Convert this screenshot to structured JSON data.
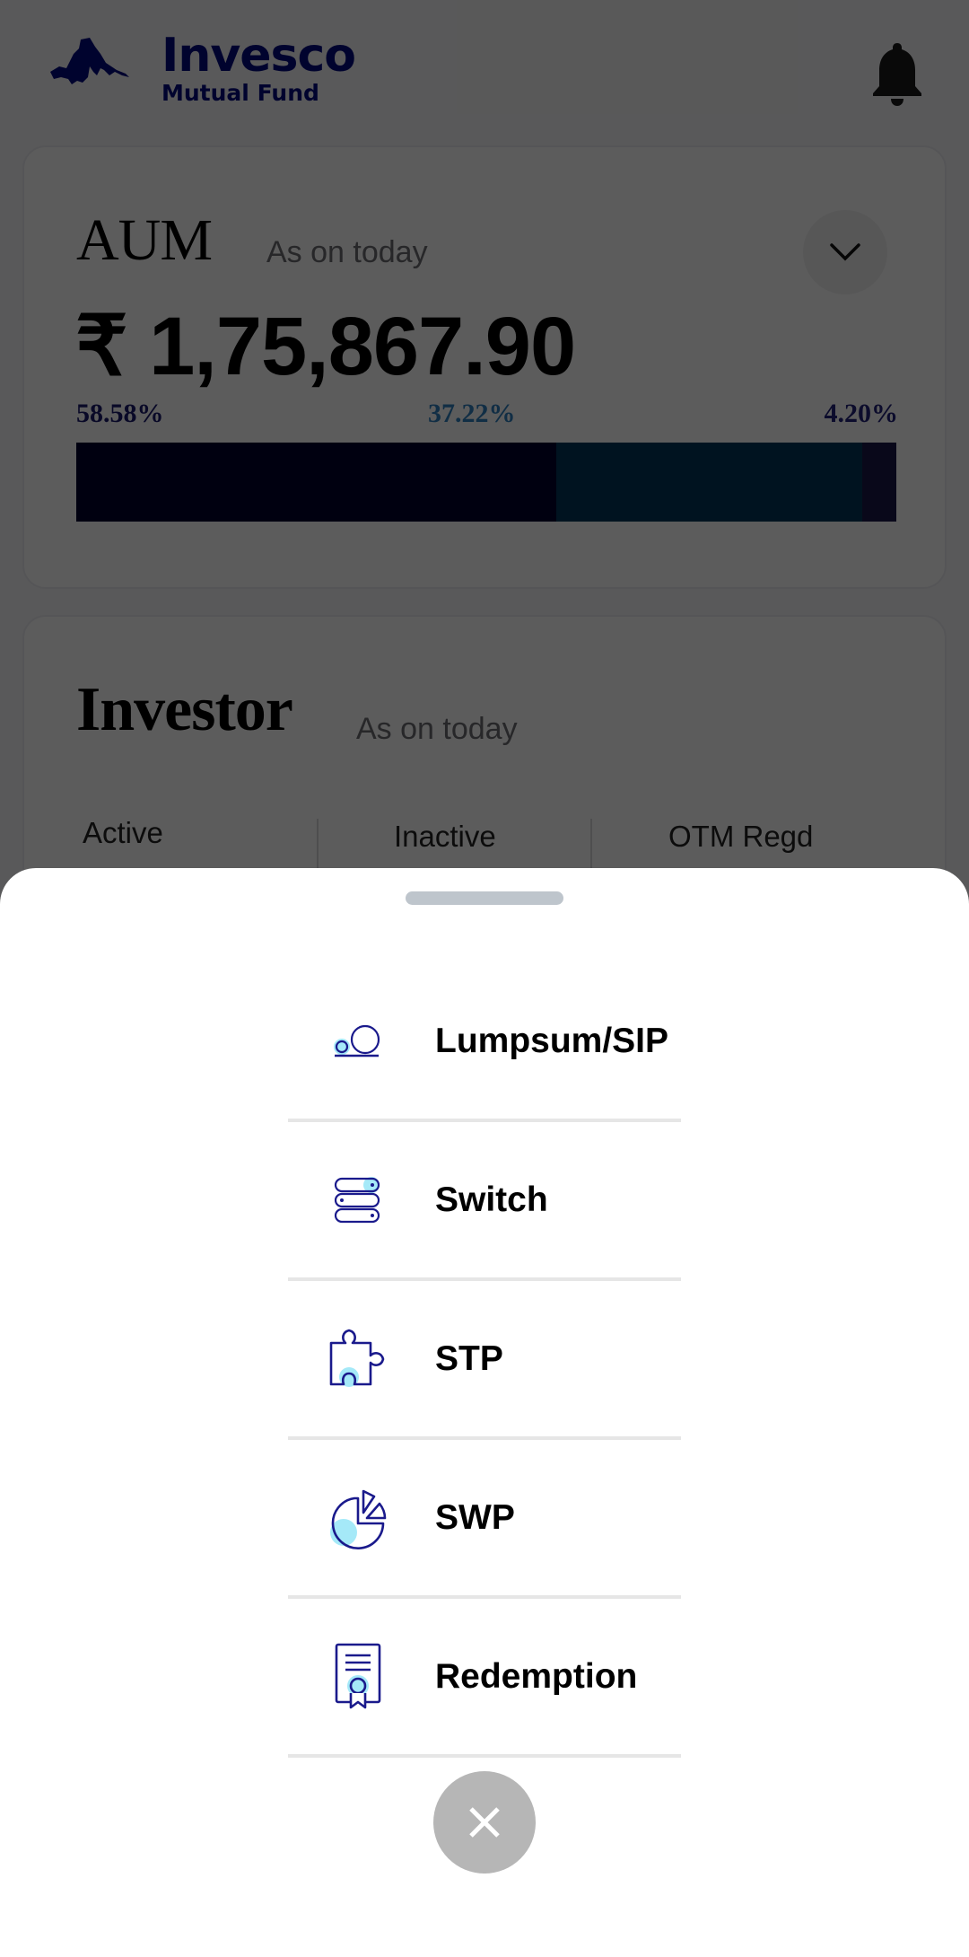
{
  "header": {
    "brand_name": "Invesco",
    "brand_subtitle": "Mutual Fund",
    "logo_icon": "mountain-logo-icon",
    "notification_icon": "bell-icon"
  },
  "aum_card": {
    "title": "AUM",
    "subtitle": "As on today",
    "expand_icon": "chevron-down-icon",
    "amount": "₹ 1,75,867.90",
    "breakdown": [
      {
        "label": "58.58%",
        "value": 58.58,
        "color": "#00002e"
      },
      {
        "label": "37.22%",
        "value": 37.22,
        "color": "#003559"
      },
      {
        "label": "4.20%",
        "value": 4.2,
        "color": "#1b1848"
      }
    ]
  },
  "investor_card": {
    "title": "Investor",
    "subtitle": "As on today",
    "stats": [
      {
        "label": "Active"
      },
      {
        "label": "Inactive"
      },
      {
        "label": "OTM Regd"
      }
    ]
  },
  "bottom_sheet": {
    "menu_items": [
      {
        "label": "Lumpsum/SIP",
        "icon": "coins-icon"
      },
      {
        "label": "Switch",
        "icon": "switch-stack-icon"
      },
      {
        "label": "STP",
        "icon": "puzzle-icon"
      },
      {
        "label": "SWP",
        "icon": "pie-chart-icon"
      },
      {
        "label": "Redemption",
        "icon": "certificate-icon"
      }
    ],
    "close_icon": "close-icon"
  },
  "colors": {
    "brand_navy": "#000a80",
    "icon_stroke": "#1a1a8c",
    "icon_accent": "#7fe0f5",
    "close_button": "#b6b6b6",
    "divider": "#e6e6e6"
  }
}
